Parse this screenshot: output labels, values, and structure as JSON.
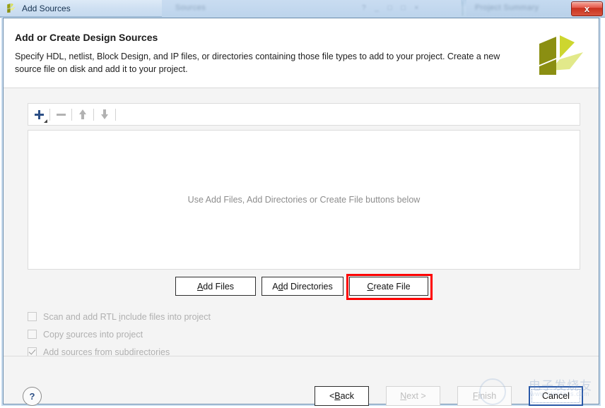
{
  "window": {
    "title": "Add Sources",
    "app_icon": "vivado-logo-icon",
    "close_label": "x"
  },
  "background": {
    "panel_label": "Sources",
    "panel_right_label": "Project Summary",
    "window_controls": "? _ □ □ ×"
  },
  "header": {
    "title": "Add or Create Design Sources",
    "description": "Specify HDL, netlist, Block Design, and IP files, or directories containing those file types to add to your project. Create a new source file on disk and add it to your project.",
    "logo": "vivado-logo"
  },
  "toolbar": {
    "buttons": [
      {
        "name": "add-button",
        "icon": "plus-icon",
        "enabled": true
      },
      {
        "name": "remove-button",
        "icon": "minus-icon",
        "enabled": false
      },
      {
        "name": "move-up-button",
        "icon": "arrow-up-icon",
        "enabled": false
      },
      {
        "name": "move-down-button",
        "icon": "arrow-down-icon",
        "enabled": false
      }
    ]
  },
  "sources_list": {
    "empty_message": "Use Add Files, Add Directories or Create File buttons below",
    "items": []
  },
  "actions": {
    "add_files": {
      "pre": "A",
      "mnemonic": "",
      "label": "Add Files",
      "mn_index": 0
    },
    "add_directories": {
      "label": "Add Directories"
    },
    "create_file": {
      "label": "Create File",
      "highlighted": true,
      "highlight_color": "#fe0000"
    }
  },
  "action_labels": {
    "add_files_a": "A",
    "add_files_b": "dd Files",
    "add_dirs_a": "A",
    "add_dirs_b": "d",
    "add_dirs_c": "d Directories",
    "create_a": "C",
    "create_b": "reate File"
  },
  "options": [
    {
      "name": "scan-rtl-include",
      "label_a": "Scan and add RTL ",
      "label_mn": "i",
      "label_b": "nclude files into project",
      "checked": false,
      "enabled": false
    },
    {
      "name": "copy-sources",
      "label_a": "Copy ",
      "label_mn": "s",
      "label_b": "ources into project",
      "checked": false,
      "enabled": false
    },
    {
      "name": "add-subdirectories",
      "label_a": "Add so",
      "label_mn": "u",
      "label_b": "rces from subdirectories",
      "checked": true,
      "enabled": false
    }
  ],
  "footer": {
    "help_label": "?",
    "back": {
      "pre": "< ",
      "mn": "B",
      "post": "ack",
      "state": "enabled"
    },
    "next": {
      "mn": "N",
      "post": "ext >",
      "state": "disabled"
    },
    "finish": {
      "mn": "F",
      "post": "inish",
      "state": "disabled"
    },
    "cancel": {
      "label": "Cancel",
      "state": "focused"
    }
  },
  "watermark": {
    "chinese": "电子发烧友",
    "url": "www.elecfans.com"
  },
  "colors": {
    "accent_blue": "#2c4f86",
    "highlight_red": "#fe0000",
    "focus_blue": "#2a59a8",
    "logo_dark": "#8b8f12",
    "logo_mid": "#cdd62f",
    "logo_light": "#e2e98a",
    "titlebar_top": "#ddeaf7",
    "body_bg": "#f4f4f4"
  }
}
